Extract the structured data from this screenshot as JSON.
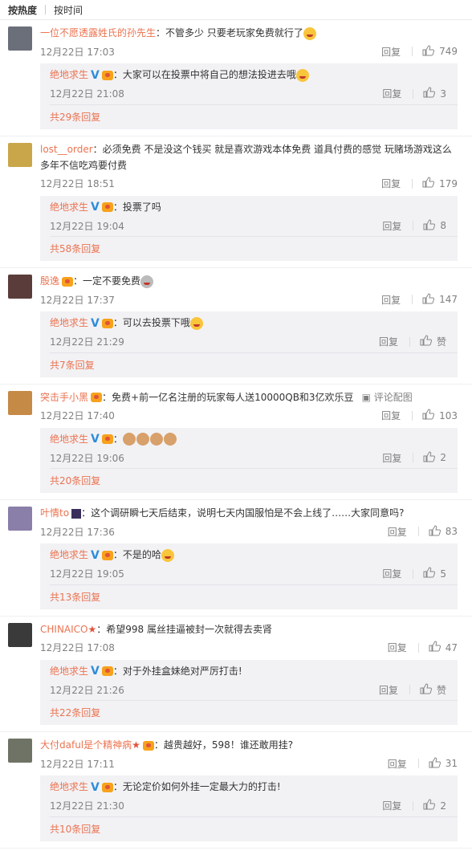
{
  "tabs": {
    "hot": "按热度",
    "time": "按时间"
  },
  "reply_label": "回复",
  "like_default": "赞",
  "view_pic": "评论配图",
  "comments": [
    {
      "user": "一位不愿透露姓氏的孙先生",
      "text": "：不管多少 只要老玩家免费就行了",
      "time": "12月22日 17:03",
      "likes": "749",
      "avatar_color": "#6b6f7a",
      "sub": {
        "user": "绝地求生",
        "text": "：大家可以在投票中将自己的想法投进去哦",
        "time": "12月22日 21:08",
        "likes": "3",
        "more": "共29条回复"
      }
    },
    {
      "user": "lost__order",
      "text": "：必须免费 不是没这个钱买 就是喜欢游戏本体免费 道具付费的感觉 玩赌场游戏这么多年不信吃鸡要付费",
      "time": "12月22日 18:51",
      "likes": "179",
      "avatar_color": "#c9a64a",
      "sub": {
        "user": "绝地求生",
        "text": "：投票了吗",
        "time": "12月22日 19:04",
        "likes": "8",
        "more": "共58条回复"
      }
    },
    {
      "user": "殷逸",
      "text": "：一定不要免费",
      "time": "12月22日 17:37",
      "likes": "147",
      "avatar_color": "#5a3d3a",
      "sub": {
        "user": "绝地求生",
        "text": "：可以去投票下哦",
        "time": "12月22日 21:29",
        "likes": "赞",
        "more": "共7条回复"
      }
    },
    {
      "user": "突击手小黑",
      "text": "：免费+前一亿名注册的玩家每人送10000QB和3亿欢乐豆",
      "time": "12月22日 17:40",
      "likes": "103",
      "avatar_color": "#c58a46",
      "sub": {
        "user": "绝地求生",
        "text": "：",
        "time": "12月22日 19:06",
        "likes": "2",
        "more": "共20条回复"
      }
    },
    {
      "user": "叶情to",
      "text": "：这个调研瞬七天后结束，说明七天内国服怕是不会上线了……大家同意吗?",
      "time": "12月22日 17:36",
      "likes": "83",
      "avatar_color": "#8a7fa8",
      "sub": {
        "user": "绝地求生",
        "text": "：不是的哈",
        "time": "12月22日 19:05",
        "likes": "5",
        "more": "共13条回复"
      }
    },
    {
      "user": "CHINAICO",
      "text": "：希望998 属丝挂逼被封一次就得去卖肾",
      "time": "12月22日 17:08",
      "likes": "47",
      "avatar_color": "#3a3a3a",
      "sub": {
        "user": "绝地求生",
        "text": "：对于外挂盒妹绝对严厉打击!",
        "time": "12月22日 21:26",
        "likes": "赞",
        "more": "共22条回复"
      }
    },
    {
      "user": "大付daful是个精神病",
      "text": "：越贵越好，598！谁还敢用挂?",
      "time": "12月22日 17:11",
      "likes": "31",
      "avatar_color": "#6f7366",
      "sub": {
        "user": "绝地求生",
        "text": "：无论定价如何外挂一定最大力的打击!",
        "time": "12月22日 21:30",
        "likes": "2",
        "more": "共10条回复"
      }
    }
  ]
}
